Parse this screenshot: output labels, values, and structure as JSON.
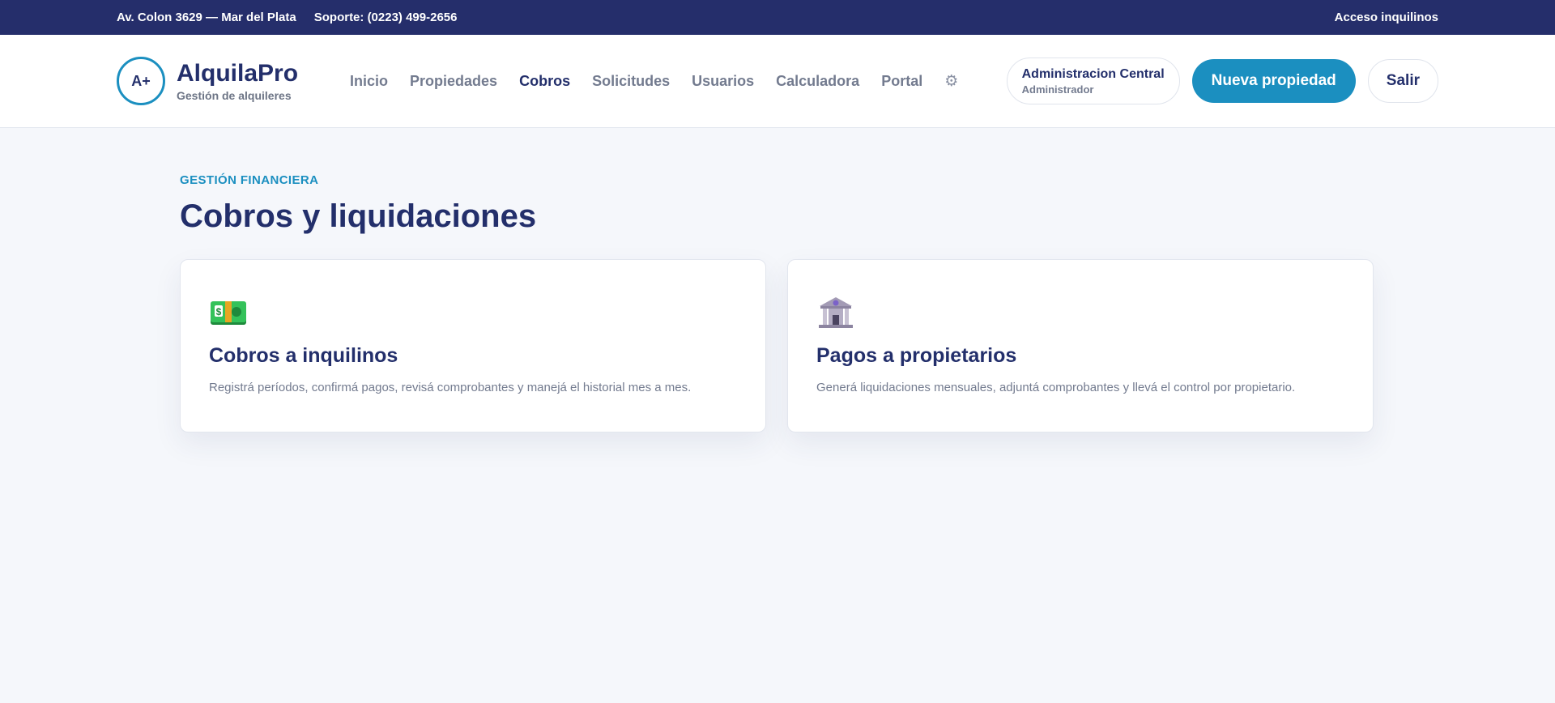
{
  "topbar": {
    "address": "Av. Colon 3629 — Mar del Plata",
    "support": "Soporte: (0223) 499-2656",
    "tenant_access": "Acceso inquilinos"
  },
  "brand": {
    "mark": "A+",
    "name": "AlquilaPro",
    "tagline": "Gestión de alquileres"
  },
  "nav": {
    "items": [
      "Inicio",
      "Propiedades",
      "Cobros",
      "Solicitudes",
      "Usuarios",
      "Calculadora",
      "Portal"
    ],
    "active": "Cobros",
    "settings_icon": "gear-icon"
  },
  "user": {
    "name": "Administracion Central",
    "role": "Administrador"
  },
  "actions": {
    "new_property": "Nueva propiedad",
    "logout": "Salir"
  },
  "page": {
    "eyebrow": "GESTIÓN FINANCIERA",
    "title": "Cobros y liquidaciones"
  },
  "cards": [
    {
      "icon": "money-banknote-icon",
      "title": "Cobros a inquilinos",
      "description": "Registrá períodos, confirmá pagos, revisá comprobantes y manejá el historial mes a mes."
    },
    {
      "icon": "bank-building-icon",
      "title": "Pagos a propietarios",
      "description": "Generá liquidaciones mensuales, adjuntá comprobantes y llevá el control por propietario."
    }
  ],
  "colors": {
    "navy": "#252e6b",
    "accent": "#1b8fc0",
    "background": "#f5f7fb",
    "muted": "#737b8f"
  }
}
